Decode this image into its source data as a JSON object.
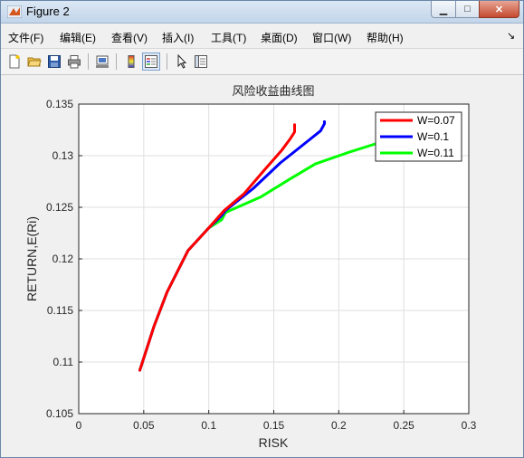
{
  "window": {
    "title": "Figure 2",
    "controls": {
      "minimize": "▁",
      "maximize": "□",
      "close": "✕"
    }
  },
  "menubar": {
    "items": [
      "文件(F)",
      "编辑(E)",
      "查看(V)",
      "插入(I)",
      "工具(T)",
      "桌面(D)",
      "窗口(W)",
      "帮助(H)"
    ],
    "overflow": "↘"
  },
  "toolbar": {
    "icons": [
      "new-figure-icon",
      "open-file-icon",
      "save-icon",
      "print-icon",
      "link-plot-icon",
      "colorbar-icon",
      "legend-icon",
      "pointer-icon",
      "property-editor-icon"
    ]
  },
  "chart_data": {
    "type": "line",
    "title": "风险收益曲线图",
    "xlabel": "RISK",
    "ylabel": "RETURN,E(Ri)",
    "xlim": [
      0,
      0.3
    ],
    "ylim": [
      0.105,
      0.135
    ],
    "xticks": [
      "0",
      "0.05",
      "0.1",
      "0.15",
      "0.2",
      "0.25",
      "0.3"
    ],
    "yticks": [
      "0.105",
      "0.11",
      "0.115",
      "0.12",
      "0.125",
      "0.13",
      "0.135"
    ],
    "grid": true,
    "legend_position": "top-right",
    "series": [
      {
        "name": "W=0.07",
        "color": "#ff0000",
        "x": [
          0.047,
          0.058,
          0.068,
          0.084,
          0.1,
          0.112,
          0.127,
          0.142,
          0.156,
          0.163,
          0.166,
          0.166
        ],
        "y": [
          0.1092,
          0.1135,
          0.1168,
          0.1208,
          0.123,
          0.1247,
          0.1263,
          0.1285,
          0.1305,
          0.1317,
          0.1323,
          0.133
        ]
      },
      {
        "name": "W=0.1",
        "color": "#0000ff",
        "x": [
          0.047,
          0.058,
          0.068,
          0.084,
          0.1,
          0.11,
          0.113,
          0.134,
          0.155,
          0.176,
          0.186,
          0.189,
          0.189
        ],
        "y": [
          0.1092,
          0.1135,
          0.1168,
          0.1208,
          0.123,
          0.1242,
          0.1247,
          0.1268,
          0.1293,
          0.1314,
          0.1324,
          0.1331,
          0.1333
        ]
      },
      {
        "name": "W=0.11",
        "color": "#00ff00",
        "x": [
          0.047,
          0.058,
          0.068,
          0.084,
          0.1,
          0.11,
          0.113,
          0.14,
          0.162,
          0.182,
          0.207,
          0.227,
          0.236
        ],
        "y": [
          0.1092,
          0.1135,
          0.1168,
          0.1208,
          0.123,
          0.1238,
          0.1245,
          0.126,
          0.1277,
          0.1292,
          0.1303,
          0.1311,
          0.1315
        ]
      }
    ]
  }
}
